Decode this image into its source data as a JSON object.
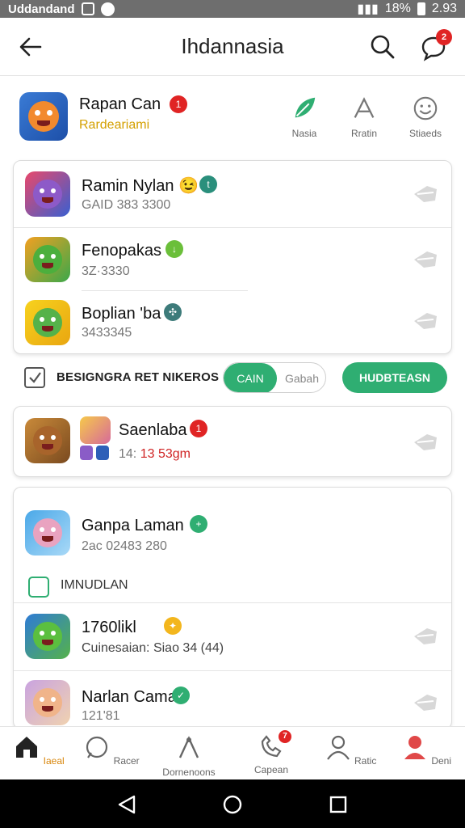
{
  "status_bar": {
    "carrier": "Uddandand",
    "battery": "18%",
    "time": "2.93"
  },
  "app_bar": {
    "title": "Ihdannasia",
    "chat_badge": "2"
  },
  "header": {
    "name": "Rapan Can",
    "name_badge": "1",
    "subtitle": "Rardeariami",
    "actions": [
      {
        "label": "Nasia",
        "icon": "leaf-icon"
      },
      {
        "label": "Rratin",
        "icon": "triangle-icon"
      },
      {
        "label": "Stiaeds",
        "icon": "smiley-icon"
      }
    ]
  },
  "group1": [
    {
      "title": "Ramin Nylan 😉",
      "badge_color": "#2a8f7c",
      "badge_glyph": "t",
      "meta": "GAID 383 3300",
      "avatar": "purple"
    },
    {
      "title": "Fenopakas",
      "badge_color": "#6bbf3a",
      "badge_glyph": "↓",
      "meta": "3Z·3330",
      "avatar": "green"
    },
    {
      "title": "Boplian 'ba",
      "badge_color": "#3d7b7a",
      "badge_glyph": "✣",
      "meta": "3433345",
      "avatar": "yellow"
    }
  ],
  "midbar": {
    "checkbox_label": "BESIGNGRA RET NIKEROS",
    "toggle_on": "CAIN",
    "toggle_off": "Gabah",
    "button": "HUDBTEASN"
  },
  "group2": {
    "title": "Saenlaba",
    "badge": "1",
    "meta_prefix": "14:",
    "meta_time": "13 53gm"
  },
  "group3": {
    "first": {
      "title": "Ganpa Laman",
      "meta": "2ac 02483 280"
    },
    "section_label": "IMNUDLAN",
    "second": {
      "title": "1760likl",
      "meta": "Cuinesaian: Siao 34 (44)"
    },
    "third": {
      "title": "Narlan Cama",
      "meta": "121'81"
    }
  },
  "bottom_nav": [
    {
      "label": "Iaeal",
      "active": true
    },
    {
      "label": "Racer",
      "active": false
    },
    {
      "label": "Dornenoons",
      "active": false
    },
    {
      "label": "Capean",
      "active": false,
      "badge": "7"
    },
    {
      "label": "Ratic",
      "active": false
    },
    {
      "label": "Deni",
      "active": false
    }
  ],
  "colors": {
    "accent_green": "#2fae72",
    "badge_red": "#e02424",
    "subtitle_yellow": "#d4a000",
    "active_orange": "#d8860b"
  }
}
